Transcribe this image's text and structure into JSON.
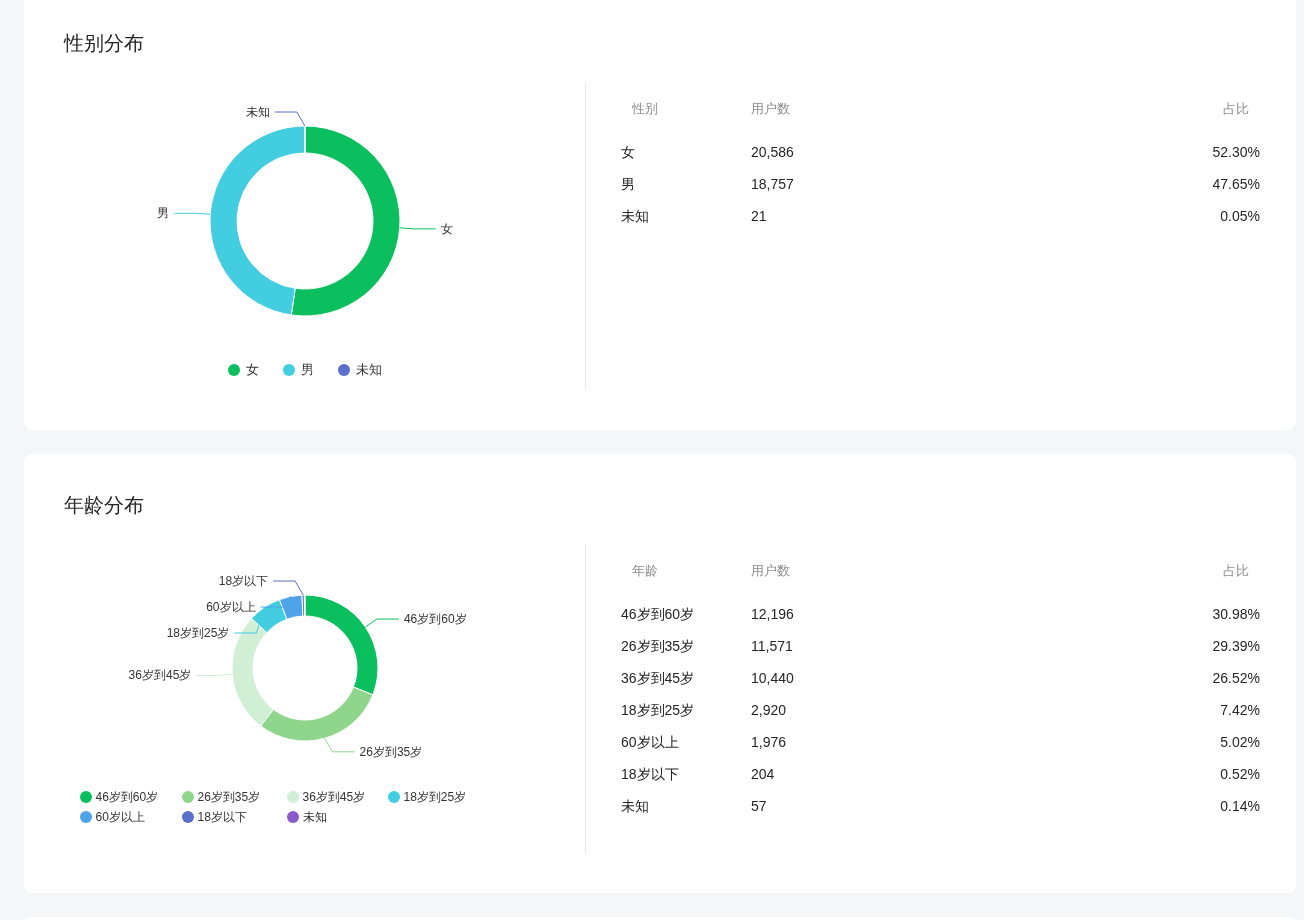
{
  "sections": [
    {
      "title": "性别分布",
      "chart_data": {
        "type": "donut",
        "categories": [
          "女",
          "男",
          "未知"
        ],
        "values": [
          52.3,
          47.65,
          0.05
        ],
        "colors": [
          "#0bbf5e",
          "#42cde0",
          "#5b6fcb"
        ],
        "annotations": [
          {
            "text": "女"
          },
          {
            "text": "男"
          },
          {
            "text": "未知"
          }
        ]
      },
      "table": {
        "columns": [
          "性别",
          "用户数",
          "占比"
        ],
        "rows": [
          [
            "女",
            "20,586",
            "52.30%"
          ],
          [
            "男",
            "18,757",
            "47.65%"
          ],
          [
            "未知",
            "21",
            "0.05%"
          ]
        ]
      }
    },
    {
      "title": "年龄分布",
      "chart_data": {
        "type": "donut",
        "categories": [
          "46岁到60岁",
          "26岁到35岁",
          "36岁到45岁",
          "18岁到25岁",
          "60岁以上",
          "18岁以下",
          "未知"
        ],
        "values": [
          30.98,
          29.39,
          26.52,
          7.42,
          5.02,
          0.52,
          0.14
        ],
        "colors": [
          "#0bbf5e",
          "#8fd68c",
          "#d1efd4",
          "#42cde0",
          "#4fa3e8",
          "#5b6fcb",
          "#8a5ac9"
        ],
        "annotations": [
          {
            "text": "46岁到60岁"
          },
          {
            "text": "26岁到35岁"
          },
          {
            "text": "36岁到45岁"
          },
          {
            "text": "18岁到25岁"
          },
          {
            "text": "60岁以上"
          },
          {
            "text": "18岁以下"
          }
        ]
      },
      "table": {
        "columns": [
          "年龄",
          "用户数",
          "占比"
        ],
        "rows": [
          [
            "46岁到60岁",
            "12,196",
            "30.98%"
          ],
          [
            "26岁到35岁",
            "11,571",
            "29.39%"
          ],
          [
            "36岁到45岁",
            "10,440",
            "26.52%"
          ],
          [
            "18岁到25岁",
            "2,920",
            "7.42%"
          ],
          [
            "60岁以上",
            "1,976",
            "5.02%"
          ],
          [
            "18岁以下",
            "204",
            "0.52%"
          ],
          [
            "未知",
            "57",
            "0.14%"
          ]
        ]
      }
    }
  ]
}
